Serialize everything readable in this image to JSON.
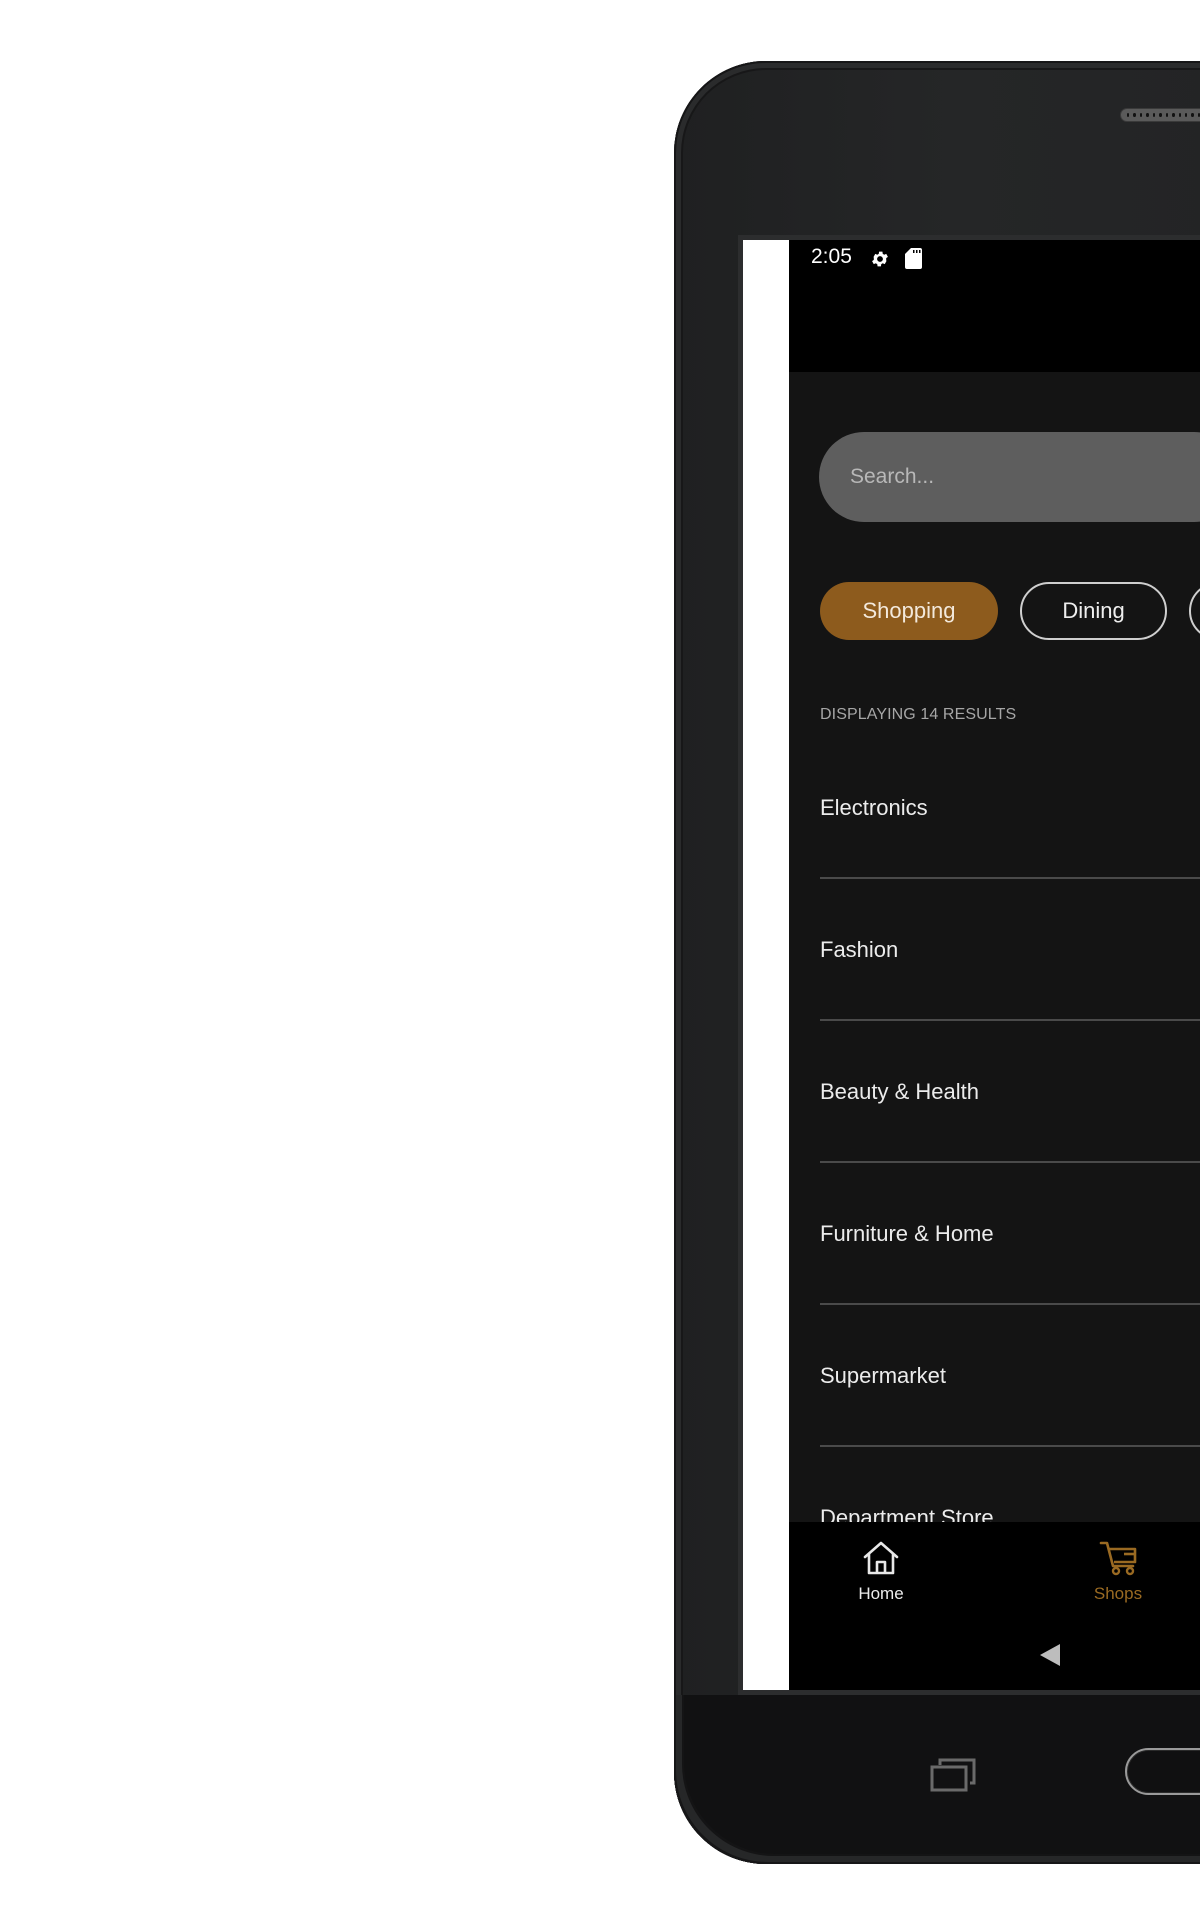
{
  "status_bar": {
    "time": "2:05",
    "icons": [
      "settings-gear-icon",
      "sd-card-icon"
    ]
  },
  "search": {
    "placeholder": "Search...",
    "value": ""
  },
  "filters": {
    "chips": [
      {
        "label": "Shopping",
        "selected": true
      },
      {
        "label": "Dining",
        "selected": false
      },
      {
        "label": "",
        "selected": false
      }
    ]
  },
  "results": {
    "label": "DISPLAYING 14 RESULTS",
    "count": 14
  },
  "list": {
    "items": [
      {
        "label": "Electronics"
      },
      {
        "label": "Fashion"
      },
      {
        "label": "Beauty & Health"
      },
      {
        "label": "Furniture & Home"
      },
      {
        "label": "Supermarket"
      },
      {
        "label": "Department Store"
      }
    ]
  },
  "bottom_nav": {
    "items": [
      {
        "label": "Home",
        "icon": "home-icon",
        "active": false
      },
      {
        "label": "Shops",
        "icon": "shopping-cart-icon",
        "active": true
      }
    ]
  },
  "colors": {
    "accent": "#8d5b1d",
    "accent_text": "#9a6a22",
    "background": "#141414",
    "search_bg": "#5e5e5e"
  }
}
